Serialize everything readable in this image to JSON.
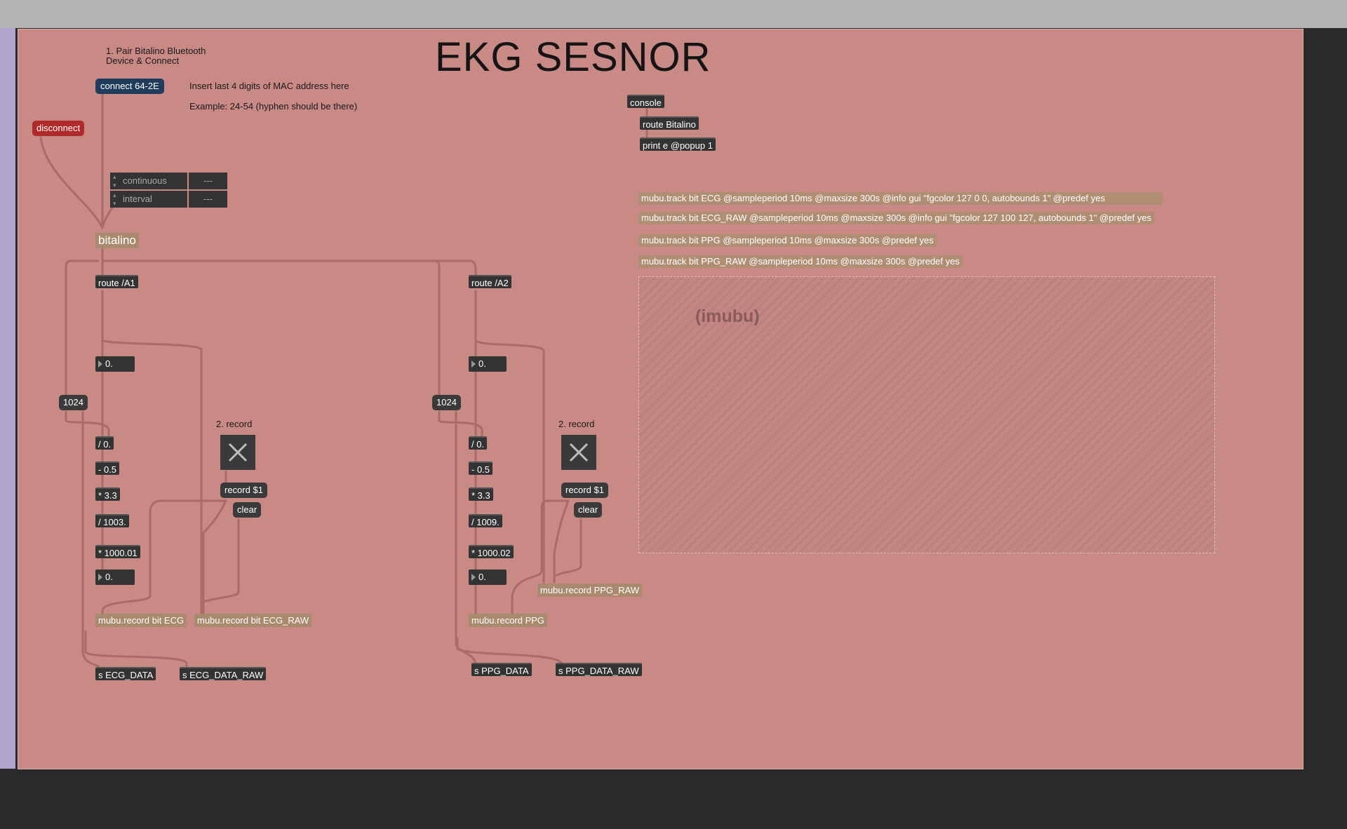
{
  "title": "EKG SESNOR",
  "instructions": {
    "pair": "1. Pair Bitalino Bluetooth\nDevice & Connect",
    "mac_hint": "Insert last 4 digits of MAC address here",
    "mac_example": "Example: 24-54 (hyphen should be there)",
    "record_left": "2. record",
    "record_right": "2. record"
  },
  "messages": {
    "connect": "connect 64-2E",
    "disconnect": "disconnect",
    "record_left": "record $1",
    "clear_left": "clear",
    "record_right": "record $1",
    "clear_right": "clear",
    "num_1024_left": "1024",
    "num_1024_right": "1024"
  },
  "attrui": {
    "continuous_label": "continuous",
    "continuous_value": "---",
    "interval_label": "interval",
    "interval_value": "---"
  },
  "objects": {
    "bitalino": "bitalino",
    "console": "console",
    "route_bitalino": "route Bitalino",
    "print": "print e @popup 1",
    "route_a1": "route /A1",
    "route_a2": "route /A2",
    "num_a1": "0.",
    "num_a2": "0.",
    "div_a1": "/ 0.",
    "sub_a1": "- 0.5",
    "mul_a1": "* 3.3",
    "div2_a1": "/ 1003.",
    "mul2_a1": "* 1000.01",
    "out_a1": "0.",
    "div_a2": "/ 0.",
    "sub_a2": "- 0.5",
    "mul_a2": "* 3.3",
    "div2_a2": "/ 1009.",
    "mul2_a2": "* 1000.02",
    "out_a2": "0.",
    "mubu_rec_ecg": "mubu.record bit ECG",
    "mubu_rec_ecg_raw": "mubu.record bit ECG_RAW",
    "mubu_rec_ppg": "mubu.record PPG",
    "mubu_rec_ppg_raw": "mubu.record PPG_RAW",
    "send_ecg": "s ECG_DATA",
    "send_ecg_raw": "s ECG_DATA_RAW",
    "send_ppg": "s PPG_DATA",
    "send_ppg_raw": "s PPG_DATA_RAW"
  },
  "mubu_tracks": [
    "mubu.track bit ECG @sampleperiod 10ms @maxsize 300s @info gui \"fgcolor 127 0 0, autobounds 1\" @predef yes",
    "mubu.track bit ECG_RAW @sampleperiod 10ms @maxsize 300s @info gui \"fgcolor 127 100 127, autobounds 1\" @predef yes",
    "mubu.track bit PPG @sampleperiod 10ms @maxsize 300s @predef yes",
    "mubu.track bit PPG_RAW @sampleperiod 10ms @maxsize 300s @predef yes"
  ],
  "imubu_label": "(imubu)",
  "colors": {
    "canvas": "#c98985",
    "wire": "#a86b67",
    "object": "#333333",
    "mubu_object": "#a98a6e"
  }
}
